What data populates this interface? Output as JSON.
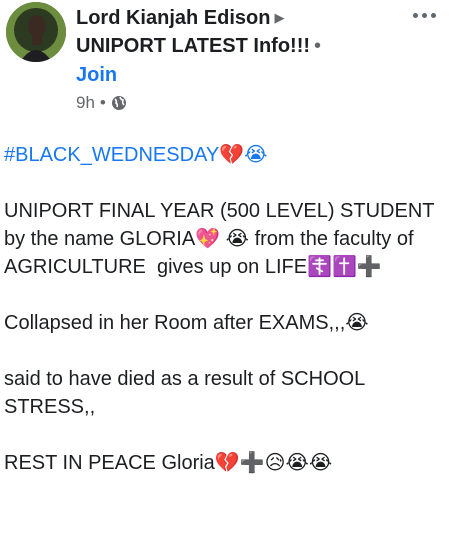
{
  "post": {
    "author": "Lord Kianjah Edison",
    "group": "UNIPORT LATEST Info!!!",
    "join_label": "Join",
    "time": "9h",
    "hashtag": "#BLACK_WEDNESDAY💔😭",
    "paragraph_1": "UNIPORT FINAL YEAR (500 LEVEL) STUDENT by the name GLORIA💖 😭 from the faculty of AGRICULTURE  gives up on LIFE☦️✝️➕",
    "paragraph_2": "Collapsed in her Room after EXAMS,,,😭",
    "paragraph_3": "said to have died as a result of SCHOOL STRESS,,",
    "paragraph_4": "REST IN PEACE Gloria💔➕😥😭😭"
  },
  "icons": {
    "arrow": "triangle-right-icon",
    "privacy": "globe-icon",
    "menu": "more-options-icon"
  },
  "colors": {
    "link": "#1877f2",
    "secondary_text": "#65676b",
    "primary_text": "#1c1e21"
  }
}
